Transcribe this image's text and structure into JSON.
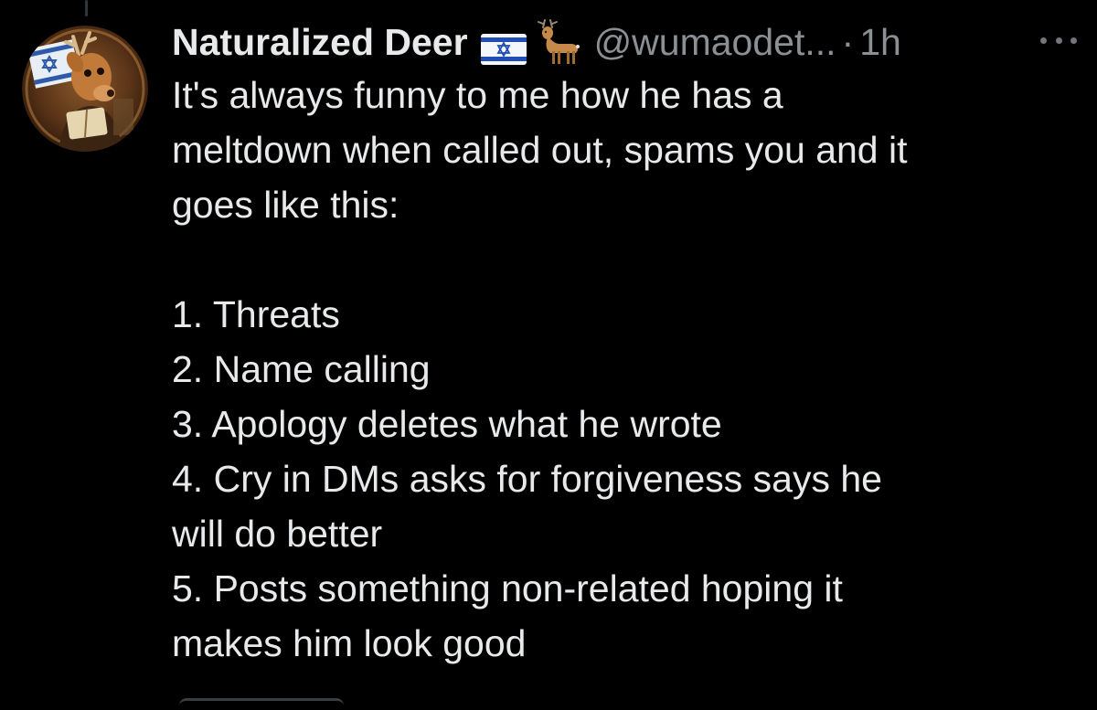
{
  "tweet": {
    "display_name": "Naturalized Deer",
    "name_badges": [
      "israel-flag-icon",
      "deer-icon"
    ],
    "handle": "@wumaodet...",
    "separator": "·",
    "time": "1h",
    "text_lines": [
      "It's always funny to me how he has a",
      "meltdown when called out, spams you and it",
      "goes like this:"
    ],
    "list_items": [
      [
        "1. Threats"
      ],
      [
        "2. Name calling"
      ],
      [
        "3. Apology deletes what he wrote"
      ],
      [
        "4. Cry in DMs asks for forgiveness says he",
        "will do better"
      ],
      [
        "5. Posts something non-related hoping it",
        "makes him look good"
      ]
    ]
  },
  "colors": {
    "background": "#000000",
    "primary_text": "#e7e9ea",
    "secondary_text": "#8b9095",
    "icon_gray": "#71767b"
  }
}
